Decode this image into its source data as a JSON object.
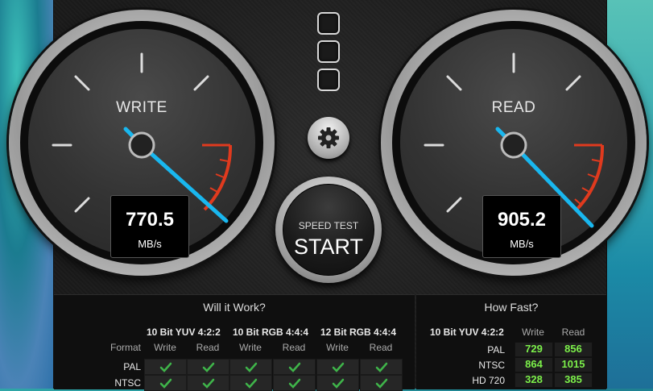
{
  "write": {
    "label": "WRITE",
    "value": "770.5",
    "unit": "MB/s"
  },
  "read": {
    "label": "READ",
    "value": "905.2",
    "unit": "MB/s"
  },
  "start": {
    "small_label": "SPEED TEST",
    "big_label": "START"
  },
  "will_it_work": {
    "title": "Will it Work?",
    "format_label": "Format",
    "groups": [
      "10 Bit YUV 4:2:2",
      "10 Bit RGB 4:4:4",
      "12 Bit RGB 4:4:4"
    ],
    "sub_labels": [
      "Write",
      "Read"
    ],
    "rows": [
      "PAL",
      "NTSC"
    ]
  },
  "how_fast": {
    "title": "How Fast?",
    "group": "10 Bit YUV 4:2:2",
    "sub_labels": [
      "Write",
      "Read"
    ],
    "rows": [
      {
        "format": "PAL",
        "write": "729",
        "read": "856"
      },
      {
        "format": "NTSC",
        "write": "864",
        "read": "1015"
      },
      {
        "format": "HD 720",
        "write": "328",
        "read": "385"
      }
    ]
  },
  "colors": {
    "needle": "#19b7ef",
    "redline": "#e03a1e",
    "check": "#3fb54a",
    "value_green": "#7cf04a"
  }
}
